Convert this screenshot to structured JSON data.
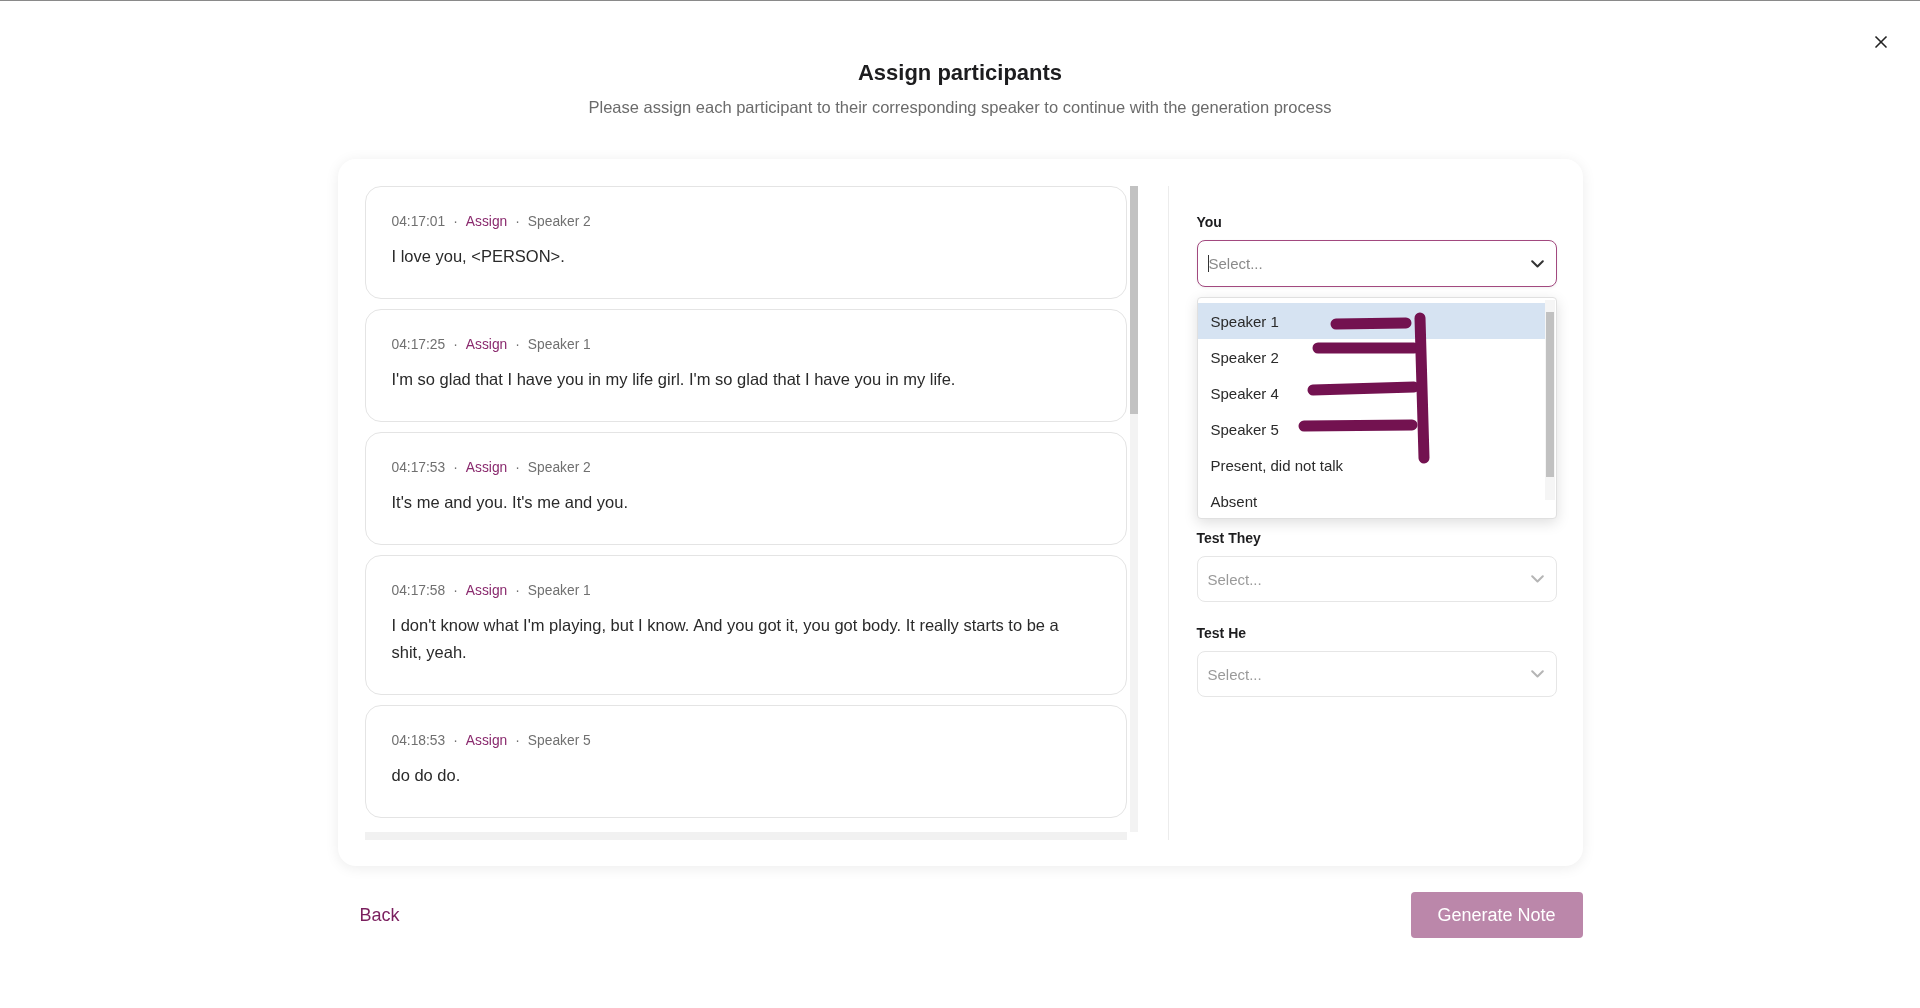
{
  "header": {
    "title": "Assign participants",
    "subtitle": "Please assign each participant to their corresponding speaker to continue with the generation process"
  },
  "transcript": [
    {
      "meta": [
        {
          "kind": "time",
          "text": "04:17:01"
        },
        {
          "kind": "separator",
          "text": "·"
        },
        {
          "kind": "action",
          "text": "Assign"
        },
        {
          "kind": "separator",
          "text": "·"
        },
        {
          "kind": "speaker",
          "text": "Speaker 2"
        }
      ],
      "text": "I love you, <PERSON>."
    },
    {
      "meta": [
        {
          "kind": "time",
          "text": "04:17:25"
        },
        {
          "kind": "separator",
          "text": "·"
        },
        {
          "kind": "action",
          "text": "Assign"
        },
        {
          "kind": "separator",
          "text": "·"
        },
        {
          "kind": "speaker",
          "text": "Speaker 1"
        }
      ],
      "text": "I'm so glad that I have you in my life girl. I'm so glad that I have you in my life."
    },
    {
      "meta": [
        {
          "kind": "time",
          "text": "04:17:53"
        },
        {
          "kind": "separator",
          "text": "·"
        },
        {
          "kind": "action",
          "text": "Assign"
        },
        {
          "kind": "separator",
          "text": "·"
        },
        {
          "kind": "speaker",
          "text": "Speaker 2"
        }
      ],
      "text": "It's me and you. It's me and you."
    },
    {
      "meta": [
        {
          "kind": "time",
          "text": "04:17:58"
        },
        {
          "kind": "separator",
          "text": "·"
        },
        {
          "kind": "action",
          "text": "Assign"
        },
        {
          "kind": "separator",
          "text": "·"
        },
        {
          "kind": "speaker",
          "text": "Speaker 1"
        }
      ],
      "text": "I don't know what I'm playing, but I know. And you got it, you got body. It really starts to be a shit, yeah."
    },
    {
      "meta": [
        {
          "kind": "time",
          "text": "04:18:53"
        },
        {
          "kind": "separator",
          "text": "·"
        },
        {
          "kind": "action",
          "text": "Assign"
        },
        {
          "kind": "separator",
          "text": "·"
        },
        {
          "kind": "speaker",
          "text": "Speaker 5"
        }
      ],
      "text": "do do do."
    }
  ],
  "participants": [
    {
      "label": "You",
      "placeholder": "Select...",
      "focused": true,
      "expanded": true,
      "options": [
        {
          "label": "Speaker 1",
          "selected": true
        },
        {
          "label": "Speaker 2",
          "selected": false
        },
        {
          "label": "Speaker 4",
          "selected": false
        },
        {
          "label": "Speaker 5",
          "selected": false
        },
        {
          "label": "Present, did not talk",
          "selected": false
        },
        {
          "label": "Absent",
          "selected": false
        }
      ]
    },
    {
      "label": "Test They",
      "placeholder": "Select...",
      "focused": false,
      "expanded": false
    },
    {
      "label": "Test He",
      "placeholder": "Select...",
      "focused": false,
      "expanded": false
    }
  ],
  "footer": {
    "back": "Back",
    "generate": "Generate Note",
    "generate_disabled": true
  }
}
